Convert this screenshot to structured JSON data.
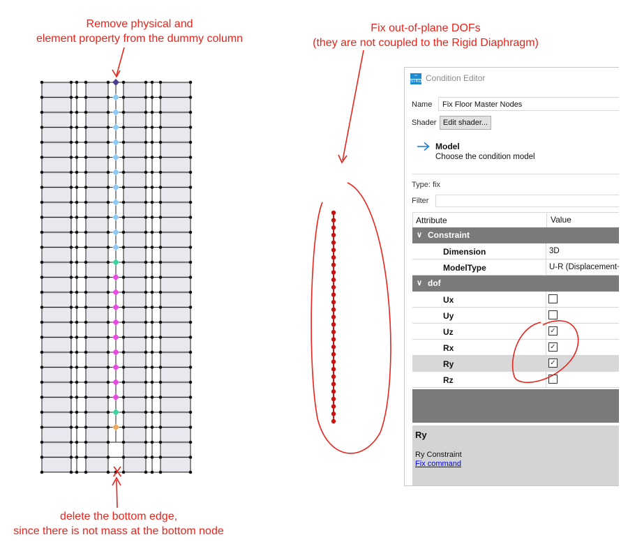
{
  "annotations": {
    "remove_property": [
      "Remove physical and",
      "element property from the dummy column"
    ],
    "fix_dofs": [
      "Fix out-of-plane DOFs",
      "(they are not coupled to the Rigid Diaphragm)"
    ],
    "delete_edge": [
      "delete the bottom edge,",
      "since there is not mass at the bottom node"
    ],
    "x_mark": "X"
  },
  "colors": {
    "annotation_red": "#e8241c",
    "master_node_red": "#cc1111",
    "node_blue": "#8ec9f3",
    "node_green": "#3dd39a",
    "node_magenta": "#e84be0",
    "node_orange": "#f0a860",
    "node_top": "#4a3f8f",
    "panel_fill": "#e8e8ee"
  },
  "model_view": {
    "node_stack_colors": [
      "top",
      "blue",
      "blue",
      "blue",
      "blue",
      "blue",
      "blue",
      "blue",
      "blue",
      "blue",
      "blue",
      "blue",
      "green",
      "magenta",
      "magenta",
      "magenta",
      "magenta",
      "magenta",
      "magenta",
      "magenta",
      "magenta",
      "magenta",
      "green",
      "orange"
    ],
    "master_nodes_count": 29
  },
  "editor": {
    "title": "Condition Editor",
    "icon_text": "STKO",
    "name_label": "Name",
    "name_value": "Fix Floor Master Nodes",
    "shader_label": "Shader",
    "shader_button": "Edit shader...",
    "model_title": "Model",
    "model_subtitle": "Choose the condition model",
    "type_text": "Type:  fix",
    "filter_label": "Filter",
    "headers": {
      "attribute": "Attribute",
      "value": "Value"
    },
    "groups": {
      "constraint": "Constraint",
      "dof": "dof"
    },
    "constraint_rows": [
      {
        "attr": "Dimension",
        "value": "3D"
      },
      {
        "attr": "ModelType",
        "value": "U-R (Displacement+"
      }
    ],
    "dof_rows": [
      {
        "attr": "Ux",
        "checked": false
      },
      {
        "attr": "Uy",
        "checked": false
      },
      {
        "attr": "Uz",
        "checked": true
      },
      {
        "attr": "Rx",
        "checked": true
      },
      {
        "attr": "Ry",
        "checked": true,
        "selected": true
      },
      {
        "attr": "Rz",
        "checked": false
      }
    ],
    "info": {
      "title": "Ry",
      "description": "Ry Constraint",
      "link": "Fix command"
    }
  }
}
